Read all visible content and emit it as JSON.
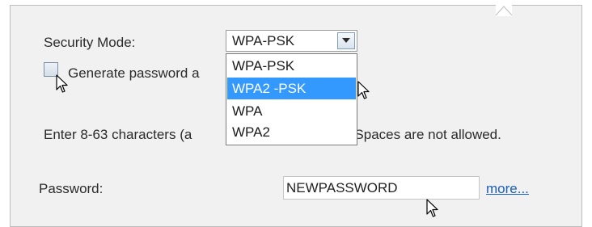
{
  "security": {
    "label": "Security Mode:",
    "selected_value": "WPA-PSK",
    "options": [
      "WPA-PSK",
      "WPA2 -PSK",
      "WPA",
      "WPA2"
    ],
    "highlighted_option": "WPA2 -PSK"
  },
  "generate_password": {
    "label": "Generate password a",
    "checked": false
  },
  "help_text": "Enter 8-63 characters (a                            annd '.'). Spaces are not allowed.",
  "password": {
    "label": "Password:",
    "value": "NEWPASSWORD"
  },
  "more_link": "more...",
  "colors": {
    "panel_bg": "#f1f1f1",
    "selection_bg": "#3399ff",
    "link": "#1a5fb4"
  },
  "icons": {
    "dropdown_arrow": "chevron-down-icon",
    "cursor": "mouse-pointer-icon"
  }
}
